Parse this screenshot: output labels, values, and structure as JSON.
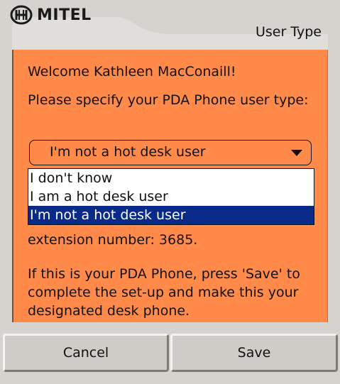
{
  "header": {
    "brand": "MITEL",
    "title": "User Type"
  },
  "content": {
    "welcome": "Welcome Kathleen MacConaill!",
    "prompt": "Please specify your PDA Phone user type:",
    "select": {
      "value": "I'm not a hot desk user",
      "options": [
        "I don't know",
        "I am a hot desk user",
        "I'm not a hot desk user"
      ],
      "selected_index": 2
    },
    "extension_text": "extension number: 3685.",
    "info_text": "If this is your PDA Phone, press 'Save' to complete the set-up and make this your designated desk phone."
  },
  "footer": {
    "cancel_label": "Cancel",
    "save_label": "Save"
  },
  "colors": {
    "panel": "#ff8a49",
    "selection": "#0a2a8a",
    "chrome": "#d6d3ce"
  }
}
